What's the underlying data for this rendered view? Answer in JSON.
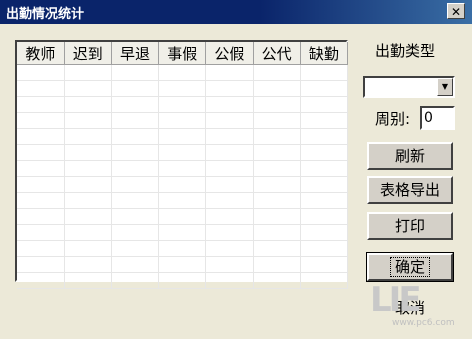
{
  "window": {
    "title": "出勤情况统计"
  },
  "table": {
    "columns": [
      "教师",
      "迟到",
      "早退",
      "事假",
      "公假",
      "公代",
      "缺勤"
    ],
    "row_count": 14
  },
  "panel": {
    "type_label": "出勤类型",
    "type_value": "",
    "week_label": "周别:",
    "week_value": "0",
    "refresh_label": "刷新",
    "export_label": "表格导出",
    "print_label": "打印",
    "ok_label": "确定",
    "cancel_label": "取消"
  },
  "watermark": {
    "text": "LIE",
    "url": "www.pc6.com"
  }
}
